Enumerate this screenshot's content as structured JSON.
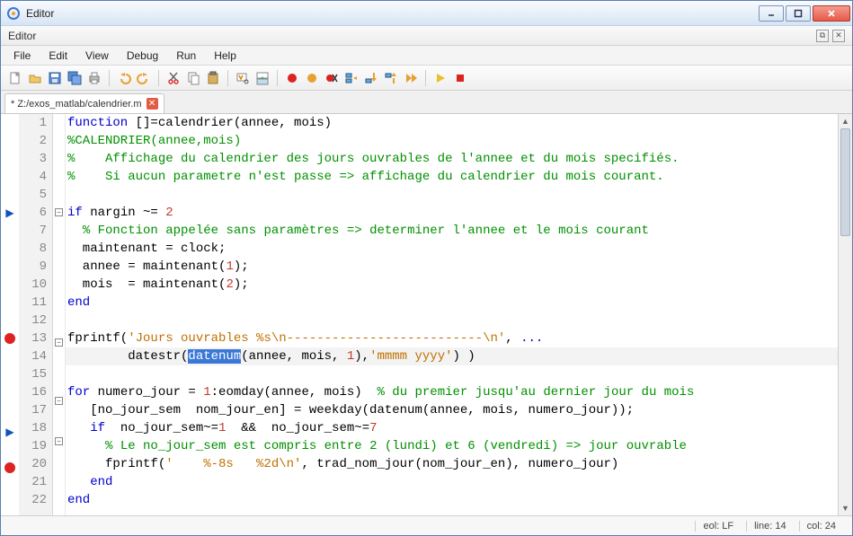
{
  "window": {
    "title": "Editor"
  },
  "panel": {
    "title": "Editor"
  },
  "menu": {
    "file": "File",
    "edit": "Edit",
    "view": "View",
    "debug": "Debug",
    "run": "Run",
    "help": "Help"
  },
  "tab": {
    "label": "* Z:/exos_matlab/calendrier.m"
  },
  "status": {
    "eol": "eol: LF",
    "line": "line: 14",
    "col": "col: 24"
  },
  "code": {
    "lines": [
      {
        "n": 1,
        "tokens": [
          {
            "t": "kw",
            "v": "function"
          },
          {
            "t": "p",
            "v": " []=calendrier(annee, mois)"
          }
        ]
      },
      {
        "n": 2,
        "tokens": [
          {
            "t": "com",
            "v": "%CALENDRIER(annee,mois)"
          }
        ]
      },
      {
        "n": 3,
        "tokens": [
          {
            "t": "com",
            "v": "%    Affichage du calendrier des jours ouvrables de l'annee et du mois specifiés."
          }
        ]
      },
      {
        "n": 4,
        "tokens": [
          {
            "t": "com",
            "v": "%    Si aucun parametre n'est passe => affichage du calendrier du mois courant."
          }
        ]
      },
      {
        "n": 5,
        "tokens": []
      },
      {
        "n": 6,
        "fold": "-",
        "arrow": true,
        "tokens": [
          {
            "t": "kw",
            "v": "if"
          },
          {
            "t": "p",
            "v": " nargin ~= "
          },
          {
            "t": "num",
            "v": "2"
          }
        ]
      },
      {
        "n": 7,
        "tokens": [
          {
            "t": "p",
            "v": "  "
          },
          {
            "t": "com",
            "v": "% Fonction appelée sans paramètres => determiner l'annee et le mois courant"
          }
        ]
      },
      {
        "n": 8,
        "tokens": [
          {
            "t": "p",
            "v": "  maintenant = clock;"
          }
        ]
      },
      {
        "n": 9,
        "tokens": [
          {
            "t": "p",
            "v": "  annee = maintenant("
          },
          {
            "t": "num",
            "v": "1"
          },
          {
            "t": "p",
            "v": ");"
          }
        ]
      },
      {
        "n": 10,
        "tokens": [
          {
            "t": "p",
            "v": "  mois  = maintenant("
          },
          {
            "t": "num",
            "v": "2"
          },
          {
            "t": "p",
            "v": ");"
          }
        ]
      },
      {
        "n": 11,
        "tokens": [
          {
            "t": "kw",
            "v": "end"
          }
        ]
      },
      {
        "n": 12,
        "tokens": []
      },
      {
        "n": 13,
        "bp": true,
        "fold": "-",
        "tokens": [
          {
            "t": "p",
            "v": "fprintf("
          },
          {
            "t": "str",
            "v": "'Jours ouvrables %s\\n--------------------------\\n'"
          },
          {
            "t": "p",
            "v": ", "
          },
          {
            "t": "kw",
            "v": "..."
          }
        ]
      },
      {
        "n": 14,
        "hl": true,
        "tokens": [
          {
            "t": "p",
            "v": "        datestr("
          },
          {
            "t": "sel",
            "v": "datenum"
          },
          {
            "t": "p",
            "v": "(annee, mois, "
          },
          {
            "t": "num",
            "v": "1"
          },
          {
            "t": "p",
            "v": "),"
          },
          {
            "t": "str",
            "v": "'mmmm yyyy'"
          },
          {
            "t": "p",
            "v": ") )"
          }
        ]
      },
      {
        "n": 15,
        "tokens": []
      },
      {
        "n": 16,
        "fold": "-",
        "tokens": [
          {
            "t": "kw",
            "v": "for"
          },
          {
            "t": "p",
            "v": " numero_jour = "
          },
          {
            "t": "num",
            "v": "1"
          },
          {
            "t": "p",
            "v": ":eomday(annee, mois)  "
          },
          {
            "t": "com",
            "v": "% du premier jusqu'au dernier jour du mois"
          }
        ]
      },
      {
        "n": 17,
        "tokens": [
          {
            "t": "p",
            "v": "   [no_jour_sem  nom_jour_en] = weekday(datenum(annee, mois, numero_jour));"
          }
        ]
      },
      {
        "n": 18,
        "fold": "-",
        "arrow": true,
        "tokens": [
          {
            "t": "p",
            "v": "   "
          },
          {
            "t": "kw",
            "v": "if"
          },
          {
            "t": "p",
            "v": "  no_jour_sem~="
          },
          {
            "t": "num",
            "v": "1"
          },
          {
            "t": "p",
            "v": "  &&  no_jour_sem~="
          },
          {
            "t": "num",
            "v": "7"
          }
        ]
      },
      {
        "n": 19,
        "tokens": [
          {
            "t": "p",
            "v": "     "
          },
          {
            "t": "com",
            "v": "% Le no_jour_sem est compris entre 2 (lundi) et 6 (vendredi) => jour ouvrable"
          }
        ]
      },
      {
        "n": 20,
        "bp": true,
        "tokens": [
          {
            "t": "p",
            "v": "     fprintf("
          },
          {
            "t": "str",
            "v": "'    %-8s   %2d\\n'"
          },
          {
            "t": "p",
            "v": ", trad_nom_jour(nom_jour_en), numero_jour)"
          }
        ]
      },
      {
        "n": 21,
        "tokens": [
          {
            "t": "p",
            "v": "   "
          },
          {
            "t": "kw",
            "v": "end"
          }
        ]
      },
      {
        "n": 22,
        "tokens": [
          {
            "t": "kw",
            "v": "end"
          }
        ]
      }
    ]
  },
  "icons": {
    "toolbar": [
      "new",
      "open",
      "save",
      "saveall",
      "print",
      "sep",
      "undo",
      "redo",
      "sep",
      "cut",
      "copy",
      "paste",
      "sep",
      "find",
      "replace",
      "sep",
      "bp-toggle",
      "bp-clear",
      "step",
      "step-in",
      "step-out",
      "continue",
      "sep",
      "run",
      "stop"
    ]
  }
}
